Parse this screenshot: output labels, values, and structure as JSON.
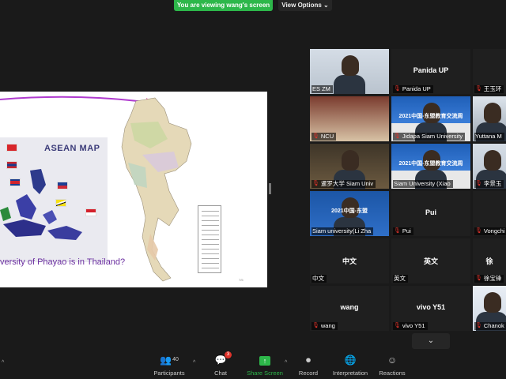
{
  "banner": {
    "text": "You are viewing wang's screen",
    "view_options": "View Options ⌄"
  },
  "slide": {
    "map_title": "ASEAN MAP",
    "question": "versity of Phayao is in Thailand?",
    "page_number": "7/5"
  },
  "gallery": [
    {
      "label": "ES ZM",
      "muted": false,
      "center": ""
    },
    {
      "label": "Panida UP",
      "muted": true,
      "center": "Panida UP"
    },
    {
      "label": "王玉环",
      "muted": true,
      "center": ""
    },
    {
      "label": "NCU",
      "muted": true,
      "center": ""
    },
    {
      "label": "Jidapa Siam University",
      "muted": true,
      "center": "",
      "banner": "2021中国-东盟教育交流周"
    },
    {
      "label": "Yuttana M",
      "muted": false,
      "center": ""
    },
    {
      "label": "暹罗大学 Siam Univ",
      "muted": true,
      "center": ""
    },
    {
      "label": "Siam University (Xiao",
      "muted": false,
      "center": "",
      "banner": "2021中国-东盟教育交流周"
    },
    {
      "label": "李景玉",
      "muted": true,
      "center": ""
    },
    {
      "label": "Siam university(Li Zha",
      "muted": false,
      "center": "",
      "banner": "2021中国-东盟"
    },
    {
      "label": "Pui",
      "muted": true,
      "center": "Pui"
    },
    {
      "label": "Vongchi",
      "muted": true,
      "center": ""
    },
    {
      "label": "中文",
      "muted": false,
      "center": "中文"
    },
    {
      "label": "英文",
      "muted": false,
      "center": "英文"
    },
    {
      "label": "徐宝锋",
      "muted": true,
      "center": "徐"
    },
    {
      "label": "wang",
      "muted": true,
      "center": "wang"
    },
    {
      "label": "vivo Y51",
      "muted": true,
      "center": "vivo Y51"
    },
    {
      "label": "Chanok",
      "muted": true,
      "center": ""
    }
  ],
  "toolbar": {
    "participants": "Participants",
    "participants_count": "40",
    "chat": "Chat",
    "chat_badge": "3",
    "share": "Share Screen",
    "record": "Record",
    "interpretation": "Interpretation",
    "reactions": "Reactions"
  },
  "colors": {
    "share_green": "#2db74a",
    "mute_red": "#e0332b",
    "tile_bg": "#1f1f1f"
  }
}
